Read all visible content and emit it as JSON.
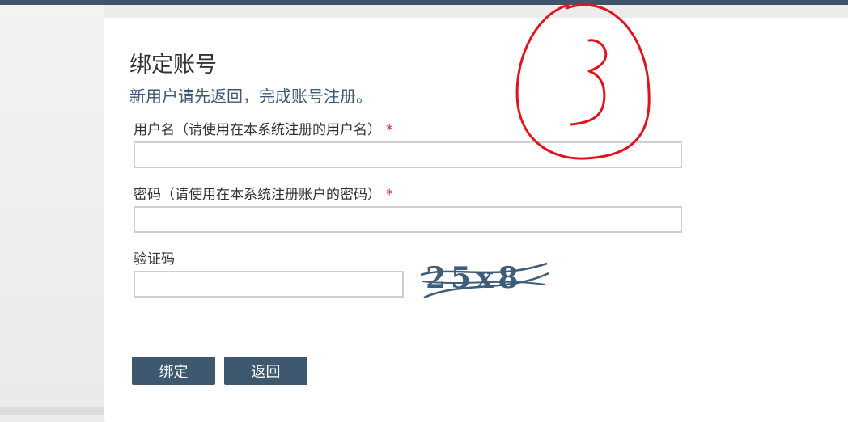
{
  "form": {
    "title": "绑定账号",
    "subtitle": "新用户请先返回，完成账号注册。",
    "username_label": "用户名（请使用在本系统注册的用户名）",
    "password_label": "密码（请使用在本系统注册账户的密码）",
    "captcha_label": "验证码",
    "required_mark": "*",
    "username_value": "",
    "password_value": "",
    "captcha_value": ""
  },
  "captcha_image": {
    "text": "25x8"
  },
  "buttons": {
    "bind_label": "绑定",
    "back_label": "返回"
  },
  "annotation": {
    "text": "3",
    "color": "#e0141b"
  },
  "colors": {
    "top_bar": "#3f5468",
    "button": "#3e5870",
    "subtitle": "#3c5a75",
    "required": "#c9302c"
  }
}
